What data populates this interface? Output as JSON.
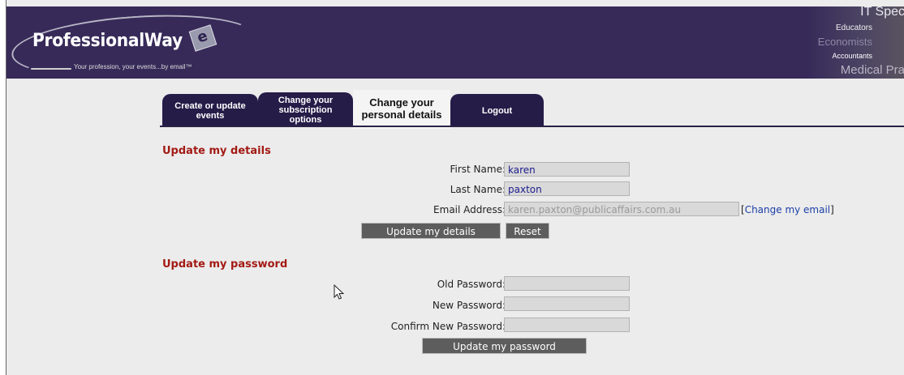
{
  "header": {
    "logo_text": "ProfessionalWay",
    "logo_badge": "e",
    "tagline": "Your profession, your events...by email™",
    "promo_words": [
      "IT Spec",
      "Educators",
      "Economists",
      "Accountants",
      "Medical Pra"
    ]
  },
  "tabs": [
    {
      "label": "Create or update events"
    },
    {
      "label": "Change your subscription options"
    },
    {
      "label": "Change your personal details",
      "active": true
    },
    {
      "label": "Logout"
    }
  ],
  "details": {
    "title": "Update my details",
    "first_name_label": "First Name:",
    "first_name_value": "karen",
    "last_name_label": "Last Name:",
    "last_name_value": "paxton",
    "email_label": "Email Address:",
    "email_value": "karen.paxton@publicaffairs.com.au",
    "change_email_open": "[",
    "change_email_link": "Change my email",
    "change_email_close": "]",
    "update_button": "Update my details",
    "reset_button": "Reset"
  },
  "password": {
    "title": "Update my password",
    "old_label": "Old Password:",
    "new_label": "New Password:",
    "confirm_label": "Confirm New Password:",
    "update_button": "Update my password"
  },
  "colors": {
    "header_bg": "#372a59",
    "tab_bg": "#261c48",
    "section_title": "#a31a14",
    "link": "#1b3ea7",
    "button_bg": "#5d5d5d"
  }
}
